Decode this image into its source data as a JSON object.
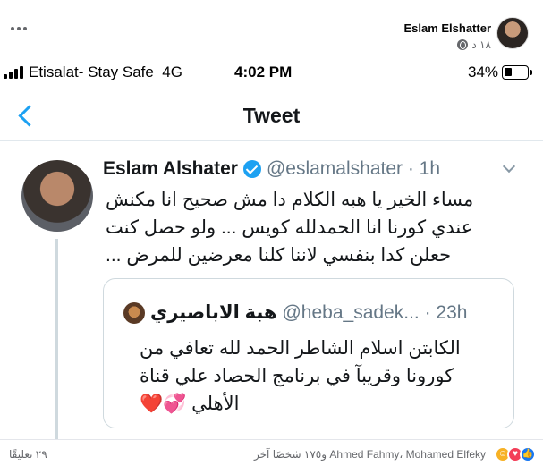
{
  "post": {
    "author": "Eslam Elshatter",
    "time": "١٨ د",
    "more_label": "...",
    "privacy_icon": "globe-icon"
  },
  "status_bar": {
    "carrier": "Etisalat- Stay Safe",
    "network": "4G",
    "time": "4:02 PM",
    "battery": "34%"
  },
  "twitter": {
    "title": "Tweet",
    "tweet": {
      "name": "Eslam Alshater",
      "handle": "@eslamalshater · 1h",
      "text": "مساء الخير يا هبه الكلام دا مش صحيح انا مكنش عندي كورنا انا الحمدلله كويس ... ولو حصل كنت حعلن كدا بنفسي لاننا كلنا معرضين للمرض ..."
    },
    "quote": {
      "name": "هبة الاباصيري",
      "handle": "@heba_sadek... · 23h",
      "text": "الكابتن اسلام الشاطر الحمد لله تعافي من كورونا وقريبآ في برنامج الحصاد علي قناة الأهلي 💞❤️"
    }
  },
  "footer": {
    "reactors": "Ahmed Fahmy، Mohamed Elfeky و١٧٥ شخصًا آخر",
    "comments": "٢٩ تعليقًا",
    "reaction_icons": [
      "like-icon",
      "love-icon",
      "haha-icon"
    ]
  },
  "colors": {
    "twitter_blue": "#1da1f2",
    "text_primary": "#14171a",
    "text_secondary": "#657786",
    "fb_secondary": "#65676b"
  }
}
